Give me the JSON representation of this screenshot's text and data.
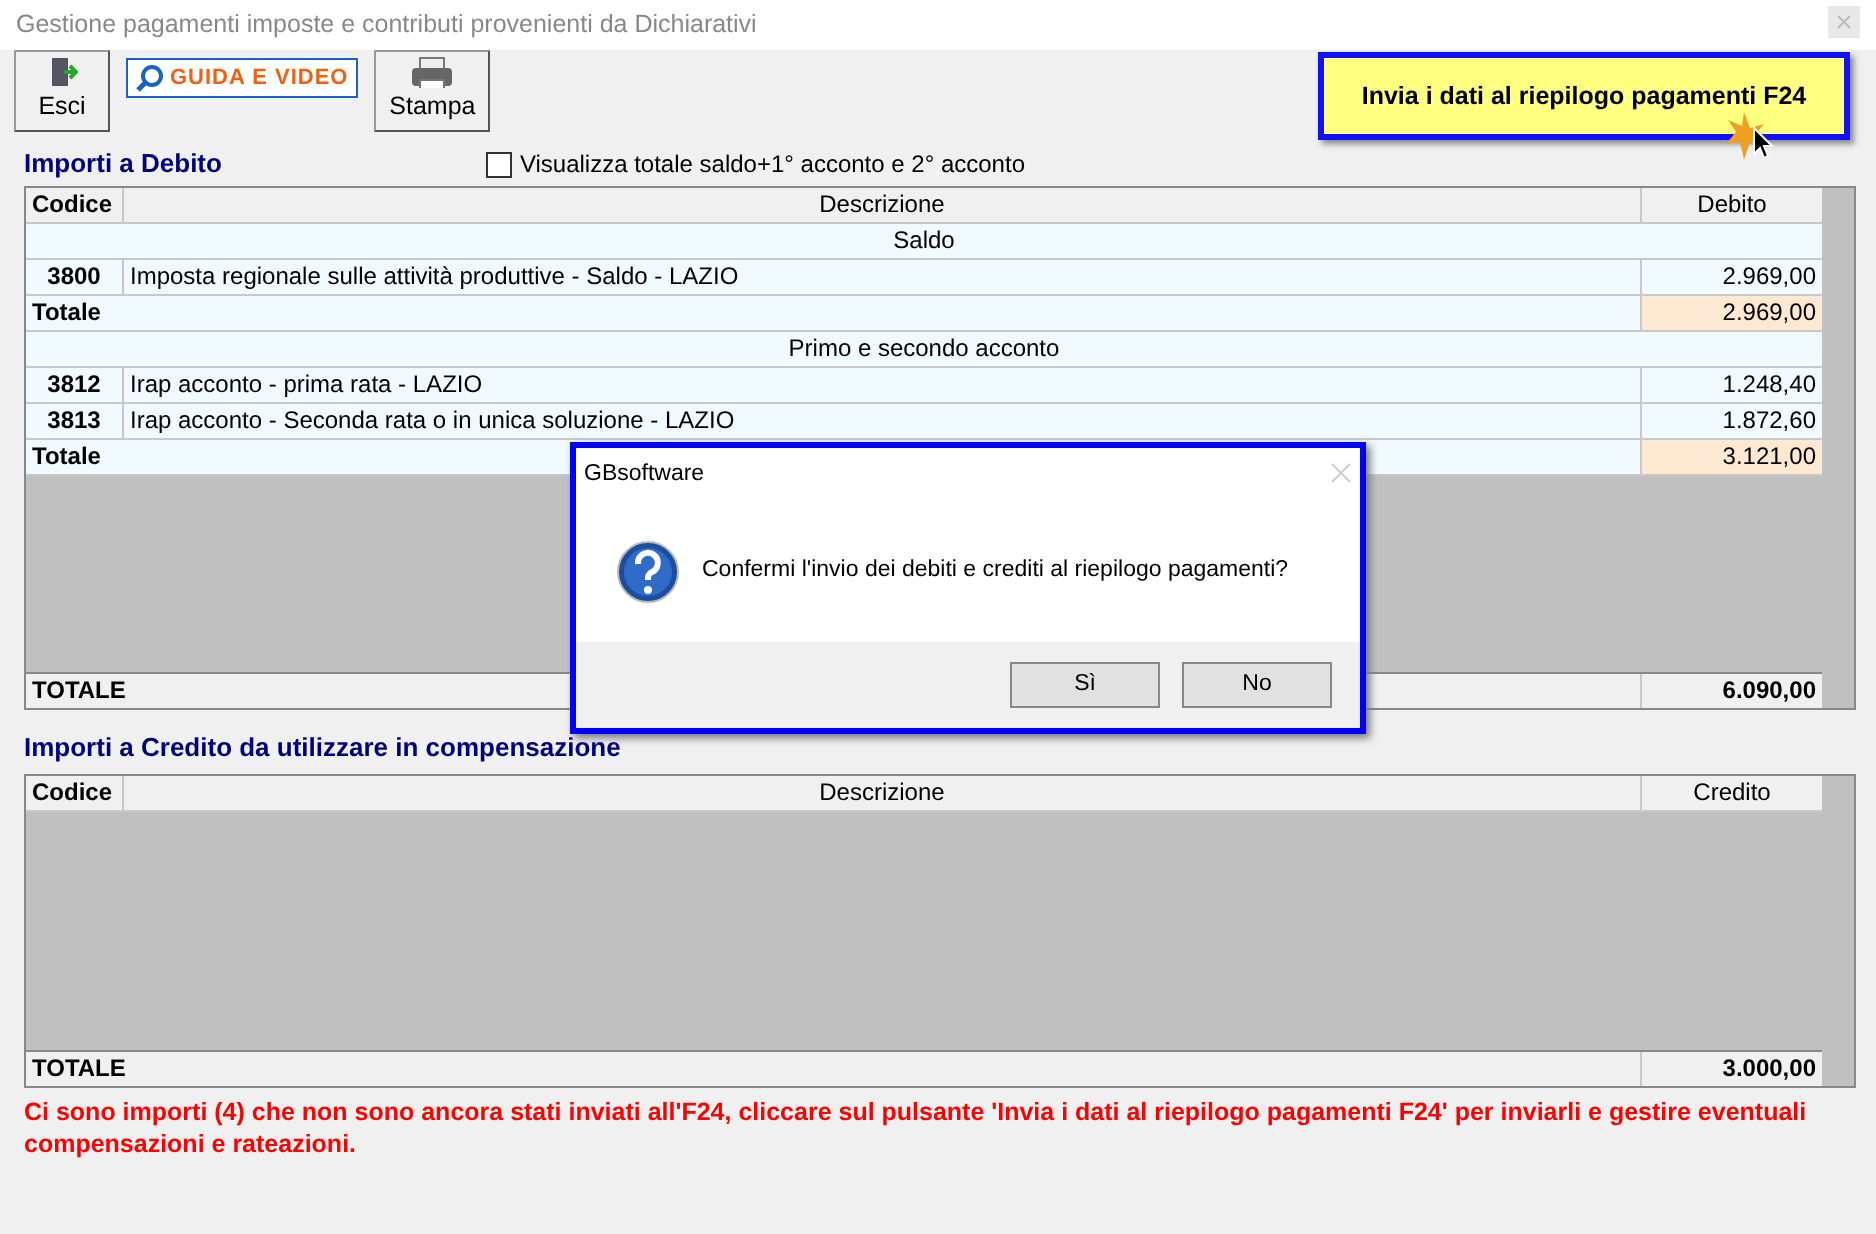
{
  "window": {
    "title": "Gestione pagamenti imposte e contributi provenienti da Dichiarativi"
  },
  "toolbar": [
    {
      "kind": "exit",
      "label": "Esci"
    },
    {
      "kind": "guide",
      "label": "GUIDA E VIDEO"
    },
    {
      "kind": "print",
      "label": "Stampa"
    }
  ],
  "send_button": {
    "label": "Invia i dati al riepilogo pagamenti F24"
  },
  "debit": {
    "title": "Importi a Debito",
    "checkbox": {
      "label": "Visualizza totale saldo+1° acconto e 2° acconto",
      "checked": false
    },
    "columns": [
      "Codice",
      "Descrizione",
      "Debito"
    ],
    "rows": [
      {
        "kind": "group",
        "label": "Saldo"
      },
      {
        "kind": "item",
        "code": "3800",
        "description": "Imposta regionale sulle attività produttive - Saldo - LAZIO",
        "amount": "2.969,00"
      },
      {
        "kind": "subtotal",
        "label": "Totale",
        "amount": "2.969,00"
      },
      {
        "kind": "group",
        "label": "Primo e secondo acconto"
      },
      {
        "kind": "item",
        "code": "3812",
        "description": "Irap acconto - prima rata - LAZIO",
        "amount": "1.248,40"
      },
      {
        "kind": "item",
        "code": "3813",
        "description": "Irap acconto - Seconda rata o in unica soluzione - LAZIO",
        "amount": "1.872,60"
      },
      {
        "kind": "subtotal",
        "label": "Totale",
        "amount": "3.121,00"
      }
    ],
    "total": {
      "label": "TOTALE",
      "amount": "6.090,00"
    }
  },
  "credit": {
    "title": "Importi a Credito da utilizzare in compensazione",
    "columns": [
      "Codice",
      "Descrizione",
      "Credito"
    ],
    "total": {
      "label": "TOTALE",
      "amount": "3.000,00"
    }
  },
  "message": "Ci sono importi (4) che non sono ancora stati inviati all'F24, cliccare sul pulsante 'Invia i dati al riepilogo pagamenti F24' per inviarli e gestire eventuali compensazioni e rateazioni.",
  "dialog": {
    "title": "GBsoftware",
    "text": "Confermi l'invio dei debiti e crediti al riepilogo pagamenti?",
    "buttons": [
      "Sì",
      "No"
    ]
  }
}
